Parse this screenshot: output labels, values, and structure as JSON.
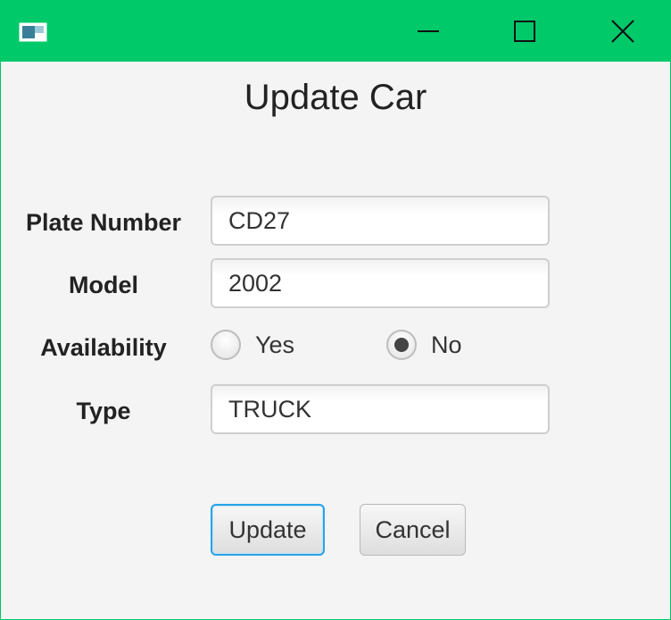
{
  "window": {
    "icon": "app-window-icon",
    "controls": [
      "minimize-icon",
      "maximize-icon",
      "close-icon"
    ],
    "accent_color": "#00c96a"
  },
  "dialog": {
    "title": "Update Car"
  },
  "form": {
    "plate_label": "Plate Number",
    "plate_value": "CD27",
    "model_label": "Model",
    "model_value": "2002",
    "availability_label": "Availability",
    "availability_options": [
      {
        "label": "Yes",
        "selected": false
      },
      {
        "label": "No",
        "selected": true
      }
    ],
    "type_label": "Type",
    "type_value": "TRUCK"
  },
  "buttons": {
    "update_label": "Update",
    "cancel_label": "Cancel"
  }
}
